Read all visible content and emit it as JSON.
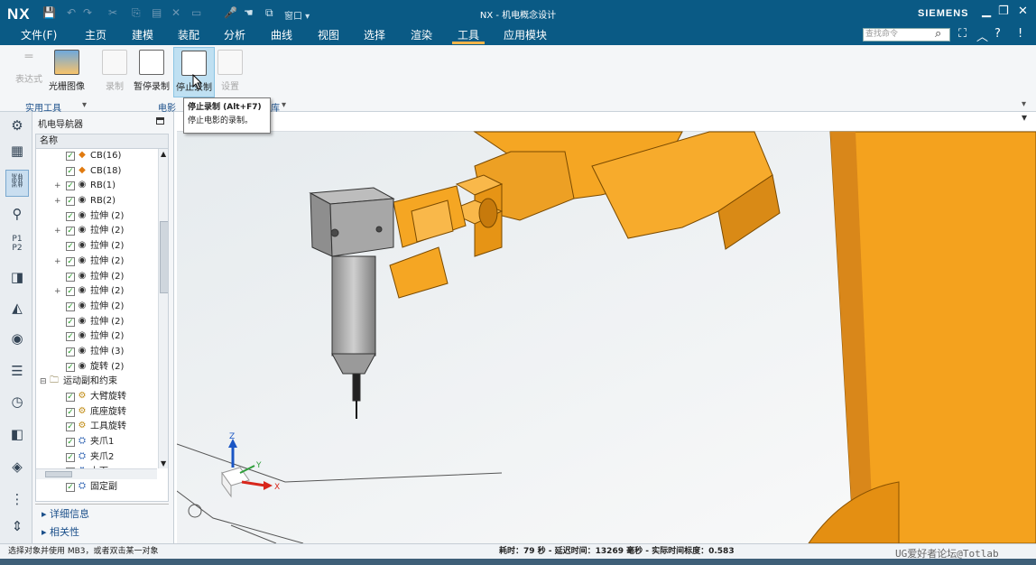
{
  "app": {
    "logo": "NX",
    "title": "NX - 机电概念设计",
    "brand": "SIEMENS",
    "window_dropdown": "窗口 ▾"
  },
  "menu": [
    "文件(F)",
    "主页",
    "建模",
    "装配",
    "分析",
    "曲线",
    "视图",
    "选择",
    "渲染",
    "工具",
    "应用模块"
  ],
  "active_menu": "工具",
  "search": {
    "placeholder": "查找命令"
  },
  "ribbon": {
    "buttons": [
      {
        "label": "表达式",
        "icon": "expression-icon",
        "enabled": false
      },
      {
        "label": "光栅图像",
        "icon": "raster-image-icon",
        "enabled": true
      },
      {
        "label": "录制",
        "icon": "film-record-icon",
        "enabled": false
      },
      {
        "label": "暂停录制",
        "icon": "film-pause-icon",
        "enabled": true
      },
      {
        "label": "停止录制",
        "icon": "film-stop-icon",
        "enabled": true
      },
      {
        "label": "设置",
        "icon": "film-settings-icon",
        "enabled": false
      }
    ],
    "groups": [
      "实用工具",
      "电影",
      "库"
    ]
  },
  "tooltip": {
    "title": "停止录制 (Alt+F7)",
    "desc": "停止电影的录制。"
  },
  "navigator": {
    "title": "机电导航器",
    "column": "名称",
    "rows": [
      {
        "label": "CB(16)",
        "icon": "cube-orange-icon",
        "expand": false
      },
      {
        "label": "CB(18)",
        "icon": "cube-orange-icon",
        "expand": false
      },
      {
        "label": "RB(1)",
        "icon": "eye-icon",
        "expand": true
      },
      {
        "label": "RB(2)",
        "icon": "eye-icon",
        "expand": true
      },
      {
        "label": "拉伸 (2)",
        "icon": "eye-icon",
        "expand": false
      },
      {
        "label": "拉伸 (2)",
        "icon": "eye-icon",
        "expand": true
      },
      {
        "label": "拉伸 (2)",
        "icon": "eye-icon",
        "expand": false
      },
      {
        "label": "拉伸 (2)",
        "icon": "eye-icon",
        "expand": true
      },
      {
        "label": "拉伸 (2)",
        "icon": "eye-icon",
        "expand": false
      },
      {
        "label": "拉伸 (2)",
        "icon": "eye-icon",
        "expand": true
      },
      {
        "label": "拉伸 (2)",
        "icon": "eye-icon",
        "expand": false
      },
      {
        "label": "拉伸 (2)",
        "icon": "eye-icon",
        "expand": false
      },
      {
        "label": "拉伸 (2)",
        "icon": "eye-icon",
        "expand": false
      },
      {
        "label": "拉伸 (3)",
        "icon": "eye-icon",
        "expand": false
      },
      {
        "label": "旋转 (2)",
        "icon": "eye-icon",
        "expand": false
      },
      {
        "label": "运动副和约束",
        "icon": "folder-icon",
        "folder": true
      },
      {
        "label": "大臂旋转",
        "icon": "hinge-joint-icon",
        "expand": false
      },
      {
        "label": "底座旋转",
        "icon": "hinge-joint-icon",
        "expand": false
      },
      {
        "label": "工具旋转",
        "icon": "hinge-joint-icon",
        "expand": false
      },
      {
        "label": "夹爪1",
        "icon": "gripper-joint-icon",
        "expand": false
      },
      {
        "label": "夹爪2",
        "icon": "gripper-joint-icon",
        "expand": false
      },
      {
        "label": "上下",
        "icon": "gripper-joint-icon",
        "expand": false
      },
      {
        "label": "固定副",
        "icon": "gripper-joint-icon",
        "expand": false
      }
    ],
    "sections": [
      "详细信息",
      "相关性"
    ]
  },
  "status": {
    "prompt": "选择对象并使用 MB3，或者双击某一对象",
    "timing": "耗时：79 秒 - 延迟时间：13269 毫秒 - 实际时间标度：0.583"
  },
  "watermark": "UG爱好者论坛@Totlab",
  "colors": {
    "title_bar": "#0a5a85",
    "accent": "#ffb44a",
    "part_orange": "#f5a623",
    "part_grey": "#a9a9a9"
  }
}
